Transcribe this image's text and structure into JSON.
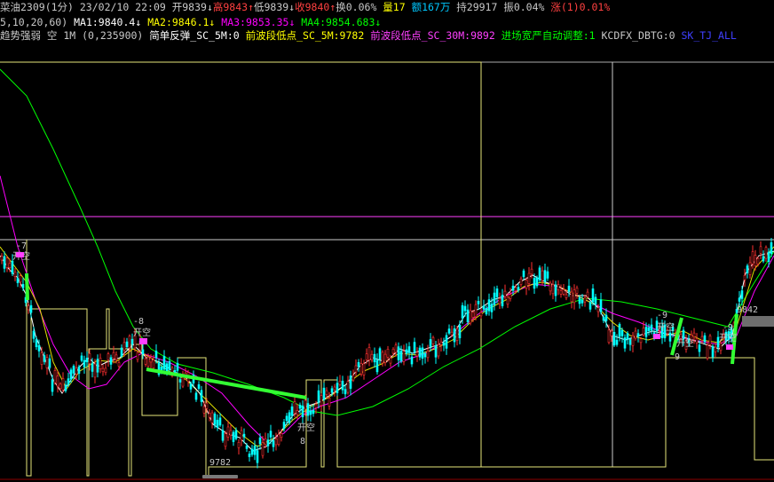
{
  "header": {
    "row1": [
      {
        "text": "菜油2309(1分) 23/02/10 22:09 ",
        "color": "#c8c8c8"
      },
      {
        "text": "开9839↓",
        "color": "#c8c8c8"
      },
      {
        "text": "高9843↑",
        "color": "#ff4040"
      },
      {
        "text": "低9839↓",
        "color": "#c8c8c8"
      },
      {
        "text": "收9840↑",
        "color": "#ff4040"
      },
      {
        "text": "换0.06% ",
        "color": "#c8c8c8"
      },
      {
        "text": "量17 ",
        "color": "#ffff00"
      },
      {
        "text": "额167万 ",
        "color": "#00c8ff"
      },
      {
        "text": "持29917 ",
        "color": "#c8c8c8"
      },
      {
        "text": "振0.04% ",
        "color": "#c8c8c8"
      },
      {
        "text": "涨(1)0.01%",
        "color": "#ff4040"
      }
    ],
    "row2": [
      {
        "text": "5,10,20,60) ",
        "color": "#c8c8c8"
      },
      {
        "text": "MA1:9840.4↓ ",
        "color": "#ffffff"
      },
      {
        "text": "MA2:9846.1↓ ",
        "color": "#ffff00"
      },
      {
        "text": "MA3:9853.35↓ ",
        "color": "#ff00ff"
      },
      {
        "text": "MA4:9854.683↓",
        "color": "#00ff00"
      }
    ],
    "row3": [
      {
        "text": "趋势强弱 空 1M (0,235900) ",
        "color": "#c8c8c8"
      },
      {
        "text": "简单反弹_SC_5M:0 ",
        "color": "#ffffff"
      },
      {
        "text": "前波段低点_SC_5M:9782 ",
        "color": "#ffff00"
      },
      {
        "text": "前波段低点_SC_30M:9892 ",
        "color": "#ff40ff"
      },
      {
        "text": "进场宽严自动调整:1 ",
        "color": "#00ff00"
      },
      {
        "text": "KCDFX_DBTG:0 ",
        "color": "#c8c8c8"
      },
      {
        "text": "SK_TJ_ALL",
        "color": "#4040ff"
      }
    ]
  },
  "chart_labels": {
    "kai_kong": "开空",
    "sig_minus7": "-7",
    "sig_minus8": "-8",
    "sig_minus9": "-9",
    "sig_9": "9",
    "sig_8": "8",
    "low_9782": "9782",
    "price_9842": "9842"
  },
  "chart_data": {
    "type": "line",
    "title": "菜油2309(1分)",
    "series": [
      {
        "name": "MA1",
        "color": "#ffffff"
      },
      {
        "name": "MA2",
        "color": "#ffff00"
      },
      {
        "name": "MA3",
        "color": "#ff00ff"
      },
      {
        "name": "MA4",
        "color": "#00ff00"
      }
    ],
    "levels": {
      "low_marker": 9782,
      "price_marker": 9842
    },
    "colors": {
      "up": "#ff3030",
      "down": "#00ffff",
      "bg": "#000000"
    }
  }
}
